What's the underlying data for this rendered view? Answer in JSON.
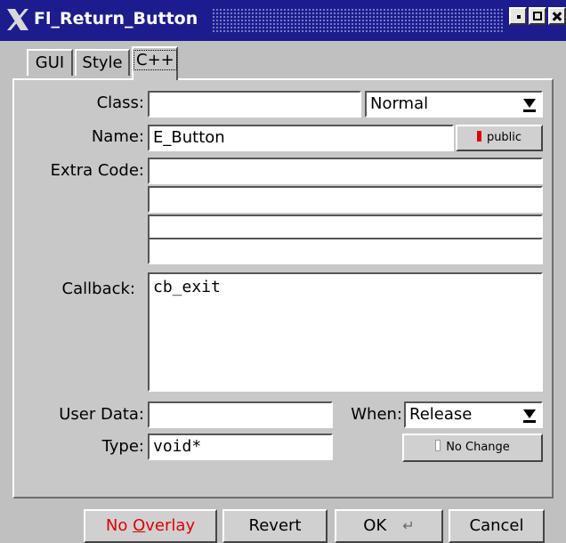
{
  "window": {
    "title": "Fl_Return_Button"
  },
  "tabs": [
    {
      "label": "GUI"
    },
    {
      "label": "Style"
    },
    {
      "label": "C++"
    }
  ],
  "cpp": {
    "class_label": "Class:",
    "class_value": "",
    "class_type": "Normal",
    "name_label": "Name:",
    "name_value": "E_Button",
    "public_label": "public",
    "extra_code_label": "Extra Code:",
    "extra_code_lines": [
      "",
      "",
      "",
      ""
    ],
    "callback_label": "Callback:",
    "callback_value": "cb_exit",
    "user_data_label": "User Data:",
    "user_data_value": "",
    "when_label": "When:",
    "when_value": "Release",
    "type_label": "Type:",
    "type_value": "void*",
    "no_change_label": "No Change"
  },
  "footer": {
    "no_overlay_pre": "No ",
    "no_overlay_ul": "O",
    "no_overlay_post": "verlay",
    "revert_label": "Revert",
    "ok_label": "OK",
    "cancel_label": "Cancel"
  },
  "colors": {
    "titlebar": "#1c1c8f",
    "no_overlay_text": "#e00000",
    "led_on": "#e0000e"
  }
}
